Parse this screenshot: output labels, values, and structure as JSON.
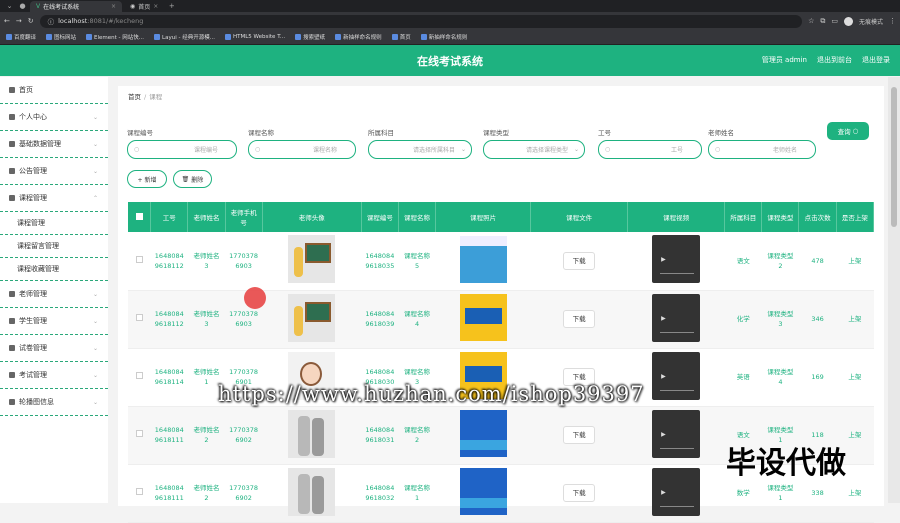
{
  "browser": {
    "tabs": [
      {
        "label": "在线考试系统",
        "active": true
      },
      {
        "label": "首页",
        "active": false
      }
    ],
    "url_host": "localhost",
    "url_rest": ":8081/#/kecheng",
    "profile_label": "无痕模式",
    "bookmarks": [
      "百度翻译",
      "图标网站",
      "Element - 网站快...",
      "Layui - 经典开源模...",
      "HTML5 Website T...",
      "搜索壁纸",
      "新抽样命名规则",
      "首页",
      "新抽样命名规则"
    ]
  },
  "header": {
    "title": "在线考试系统",
    "links": [
      "管理员 admin",
      "退出到前台",
      "退出登录"
    ]
  },
  "sidebar": {
    "items": [
      {
        "label": "首页",
        "icon": "home-icon"
      },
      {
        "label": "个人中心",
        "icon": "user-icon"
      },
      {
        "label": "基础数据管理",
        "icon": "data-icon"
      },
      {
        "label": "公告管理",
        "icon": "notice-icon"
      },
      {
        "label": "课程管理",
        "icon": "course-icon",
        "children": [
          "课程管理",
          "课程留言管理",
          "课程收藏管理"
        ]
      },
      {
        "label": "老师管理",
        "icon": "teacher-icon"
      },
      {
        "label": "学生管理",
        "icon": "student-icon"
      },
      {
        "label": "试卷管理",
        "icon": "paper-icon"
      },
      {
        "label": "考试管理",
        "icon": "exam-icon"
      },
      {
        "label": "轮播图信息",
        "icon": "carousel-icon"
      }
    ]
  },
  "breadcrumb": {
    "home": "首页",
    "sep": "/",
    "current": "课程"
  },
  "filters": [
    {
      "label": "课程编号",
      "placeholder": "课程编号"
    },
    {
      "label": "课程名称",
      "placeholder": "课程名称"
    },
    {
      "label": "所属科目",
      "placeholder": "请选择所属科目"
    },
    {
      "label": "课程类型",
      "placeholder": "请选择课程类型"
    },
    {
      "label": "工号",
      "placeholder": "工号"
    },
    {
      "label": "老师姓名",
      "placeholder": "老师姓名"
    }
  ],
  "search_button": "查询",
  "add_button": "+ 新增",
  "delete_button": "删除",
  "table": {
    "headers": [
      "工号",
      "老师姓名",
      "老师手机号",
      "老师头像",
      "课程编号",
      "课程名称",
      "课程照片",
      "课程文件",
      "课程视频",
      "所属科目",
      "课程类型",
      "点击次数",
      "是否上架"
    ],
    "rows": [
      {
        "gh": "16480849618112",
        "name": "老师姓名3",
        "phone": "17703786903",
        "code": "16480849618035",
        "cname": "课程名称5",
        "subject": "语文",
        "type": "课程类型2",
        "clicks": "478",
        "status": "上架"
      },
      {
        "gh": "16480849618112",
        "name": "老师姓名3",
        "phone": "17703786903",
        "code": "16480849618039",
        "cname": "课程名称4",
        "subject": "化学",
        "type": "课程类型3",
        "clicks": "346",
        "status": "上架"
      },
      {
        "gh": "16480849618114",
        "name": "老师姓名1",
        "phone": "17703786901",
        "code": "16480849618030",
        "cname": "课程名称3",
        "subject": "英语",
        "type": "课程类型4",
        "clicks": "169",
        "status": "上架"
      },
      {
        "gh": "16480849618111",
        "name": "老师姓名2",
        "phone": "17703786902",
        "code": "16480849618031",
        "cname": "课程名称2",
        "subject": "语文",
        "type": "课程类型1",
        "clicks": "118",
        "status": "上架"
      },
      {
        "gh": "16480849618111",
        "name": "老师姓名2",
        "phone": "17703786902",
        "code": "16480849618032",
        "cname": "课程名称1",
        "subject": "数学",
        "type": "课程类型1",
        "clicks": "338",
        "status": "上架"
      }
    ],
    "download_label": "下载"
  },
  "watermark": "https://www.huzhan.com/ishop39397",
  "watermark2": "毕设代做"
}
